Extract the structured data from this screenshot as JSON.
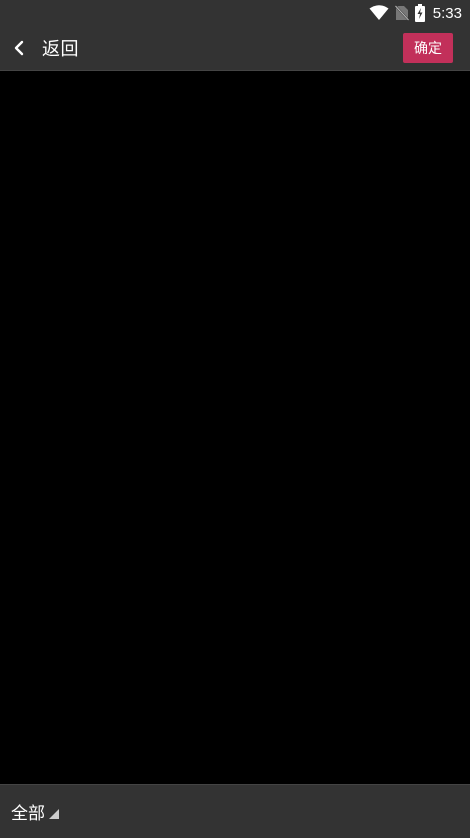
{
  "status_bar": {
    "time": "5:33",
    "icons": [
      "wifi-icon",
      "no-sim-icon",
      "battery-charging-icon"
    ]
  },
  "app_bar": {
    "back_label": "返回",
    "confirm_label": "确定",
    "confirm_color": "#c2305a",
    "background": "#333333"
  },
  "bottom_bar": {
    "filter_label": "全部"
  }
}
